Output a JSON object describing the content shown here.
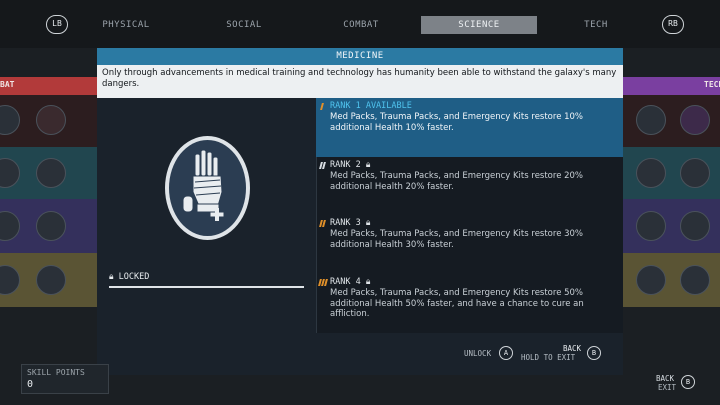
{
  "nav": {
    "left_bumper": "LB",
    "right_bumper": "RB",
    "tabs": [
      "PHYSICAL",
      "SOCIAL",
      "COMBAT",
      "SCIENCE",
      "TECH"
    ],
    "active_tab": "SCIENCE"
  },
  "background": {
    "left_label": "BAT",
    "right_label": "TECH"
  },
  "modal": {
    "title": "MEDICINE",
    "description": "Only through advancements in medical training and technology has humanity been able to withstand the galaxy's many dangers.",
    "status": "LOCKED",
    "ranks": [
      {
        "heading": "RANK 1 AVAILABLE",
        "text": "Med Packs, Trauma Packs, and Emergency Kits restore 10% additional Health 10% faster."
      },
      {
        "heading": "RANK 2",
        "text": "Med Packs, Trauma Packs, and Emergency Kits restore 20% additional Health 20% faster."
      },
      {
        "heading": "RANK 3",
        "text": "Med Packs, Trauma Packs, and Emergency Kits restore 30% additional Health 30% faster."
      },
      {
        "heading": "RANK 4",
        "text": "Med Packs, Trauma Packs, and Emergency Kits restore 50% additional Health 50% faster, and have a chance to cure an affliction."
      }
    ],
    "footer": {
      "unlock_label": "UNLOCK",
      "unlock_key": "A",
      "hold_to_exit": "HOLD TO EXIT",
      "back_label": "BACK",
      "back_key": "B"
    }
  },
  "skill_points": {
    "label": "SKILL POINTS",
    "value": "0"
  },
  "corner": {
    "back_label": "BACK",
    "exit_label": "EXIT",
    "key": "B"
  },
  "colors": {
    "accent": "#2b7aa3",
    "active_rank": "#1f5e86",
    "rank_available": "#4fc3ee",
    "rank_mark_gold": "#e0902a"
  }
}
